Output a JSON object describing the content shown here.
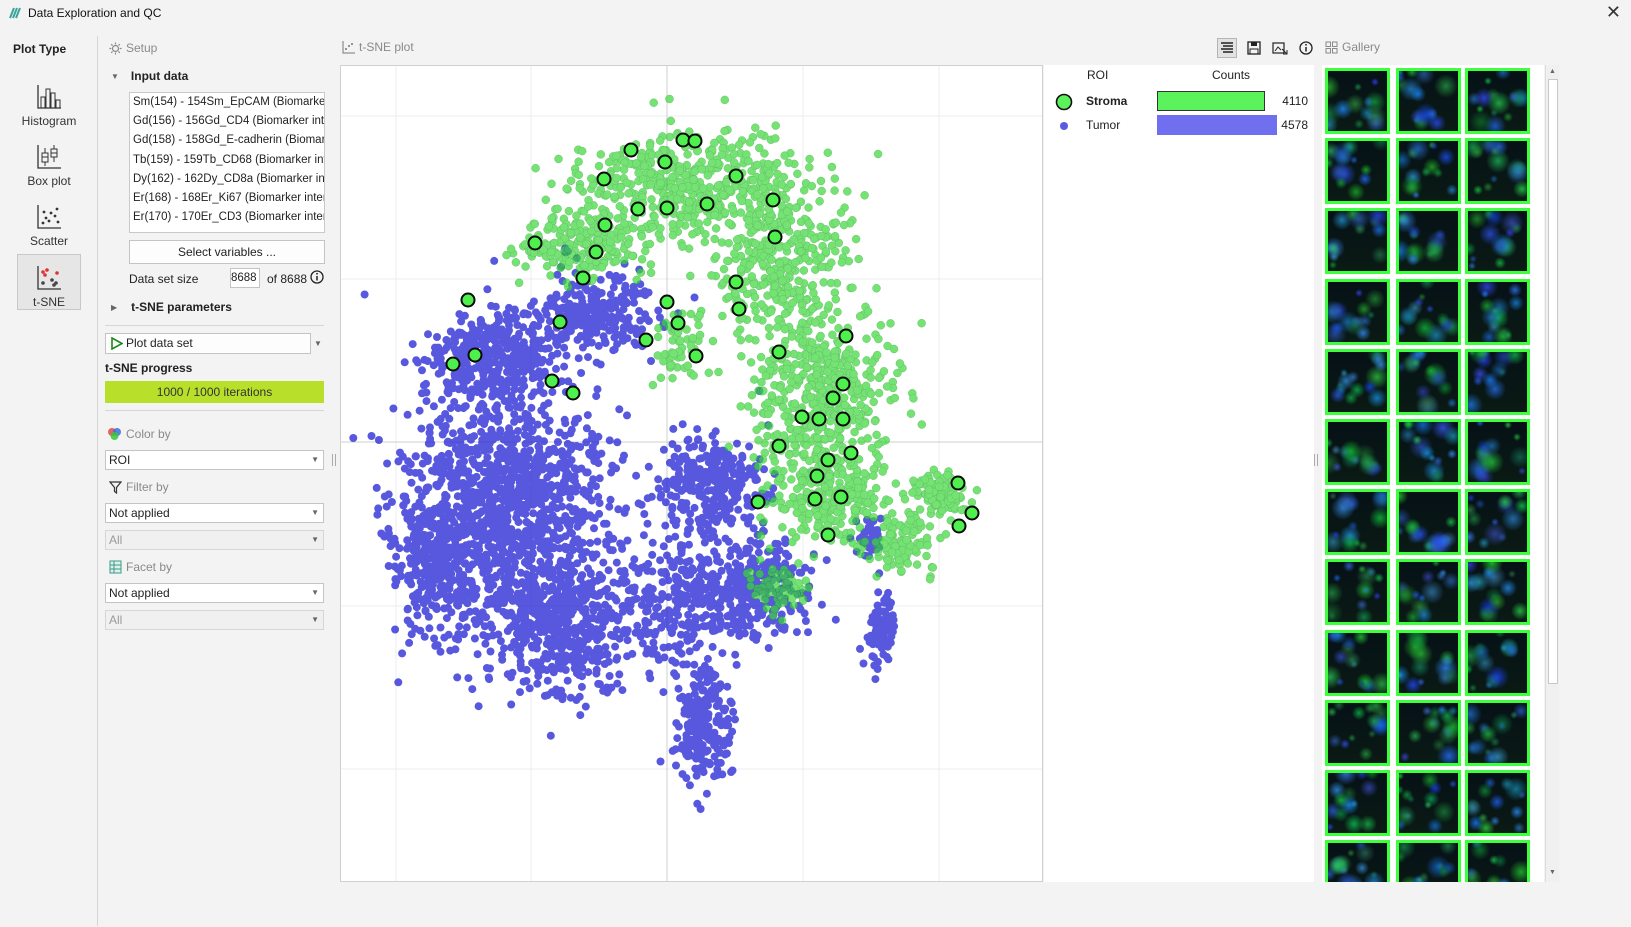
{
  "window": {
    "title": "Data Exploration and QC",
    "close_glyph": "✕"
  },
  "plot_type": {
    "heading": "Plot Type",
    "items": [
      {
        "label": "Histogram",
        "icon": "histogram-icon"
      },
      {
        "label": "Box plot",
        "icon": "boxplot-icon"
      },
      {
        "label": "Scatter",
        "icon": "scatter-icon"
      },
      {
        "label": "t-SNE",
        "icon": "tsne-icon",
        "active": true
      }
    ]
  },
  "setup": {
    "title": "Setup",
    "input_data": {
      "label": "Input data",
      "variables": [
        "Sm(154) - 154Sm_EpCAM (Biomarker",
        "Gd(156) - 156Gd_CD4 (Biomarker inte",
        "Gd(158) - 158Gd_E-cadherin (Biomark",
        "Tb(159) - 159Tb_CD68 (Biomarker inte",
        "Dy(162) - 162Dy_CD8a (Biomarker inte",
        "Er(168) - 168Er_Ki67 (Biomarker intens",
        "Er(170) - 170Er_CD3 (Biomarker intens"
      ],
      "select_button": "Select variables ...",
      "dataset_size_label": "Data set size",
      "dataset_size_value": "8688",
      "dataset_total": "of 8688"
    },
    "tsne_params_label": "t-SNE parameters",
    "plot_button": "Plot data set",
    "progress_label": "t-SNE progress",
    "progress_text": "1000 / 1000 iterations",
    "progress_fraction": 1.0,
    "color_by": {
      "label": "Color by",
      "value": "ROI"
    },
    "filter_by": {
      "label": "Filter by",
      "value": "Not applied",
      "sub_value": "All"
    },
    "facet_by": {
      "label": "Facet by",
      "value": "Not applied",
      "sub_value": "All"
    }
  },
  "plot": {
    "title": "t-SNE plot"
  },
  "legend": {
    "col_roi": "ROI",
    "col_counts": "Counts",
    "rows": [
      {
        "name": "Stroma",
        "count": "4110",
        "count_value": 4110,
        "color": "#5cf25c",
        "bold": true
      },
      {
        "name": "Tumor",
        "count": "4578",
        "count_value": 4578,
        "color": "#6f6ff0",
        "bold": false
      }
    ]
  },
  "gallery": {
    "title": "Gallery",
    "columns": 3,
    "visible_rows": 12
  },
  "colors": {
    "stroma": "#3ad83a",
    "tumor": "#2a2ad6",
    "accent_progress": "#b8e02a",
    "thumb_border": "#3dff3d"
  }
}
